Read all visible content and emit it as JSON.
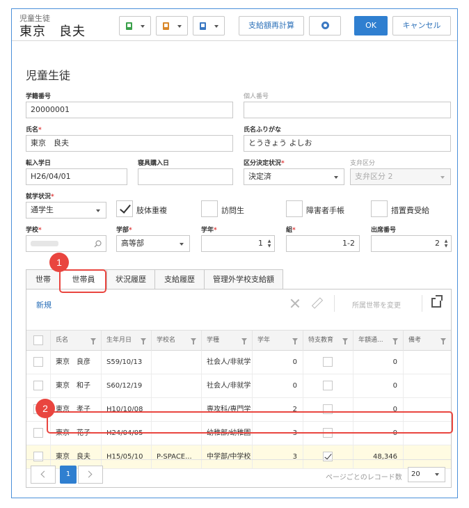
{
  "header": {
    "subtitle": "児童生徒",
    "name": "東京　良夫",
    "recalc_label": "支給額再計算",
    "ok_label": "OK",
    "cancel_label": "キャンセル"
  },
  "page_title": "児童生徒",
  "form": {
    "student_no_label": "学籍番号",
    "student_no_value": "20000001",
    "personal_no_label": "個人番号",
    "personal_no_value": "",
    "name_label": "氏名",
    "name_value": "東京　良夫",
    "kana_label": "氏名ふりがな",
    "kana_value": "とうきょう よしお",
    "transfer_date_label": "転入学日",
    "transfer_date_value": "H26/04/01",
    "bedding_date_label": "寝具購入日",
    "bedding_date_value": "",
    "category_status_label": "区分決定状況",
    "category_status_value": "決定済",
    "payment_category_label": "支弁区分",
    "payment_category_value": "支弁区分 2",
    "enrollment_label": "就学状況",
    "enrollment_value": "通学生",
    "check_limb": "肢体重複",
    "check_visiting": "訪問生",
    "check_disability": "障害者手帳",
    "check_measures": "措置費受給",
    "school_label": "学校",
    "dept_label": "学部",
    "dept_value": "高等部",
    "grade_label": "学年",
    "grade_value": "1",
    "class_label": "組",
    "class_value": "1-2",
    "seat_label": "出席番号",
    "seat_value": "2",
    "required_mark": "*"
  },
  "tabs": [
    "世帯",
    "世帯員",
    "状況履歴",
    "支給履歴",
    "管理外学校支給額"
  ],
  "grid": {
    "new_label": "新規",
    "change_label": "所属世帯を変更",
    "columns": [
      "氏名",
      "生年月日",
      "学校名",
      "学種",
      "学年",
      "特支教育",
      "年額通...",
      "備考"
    ],
    "rows": [
      {
        "name": "東京　良彦",
        "birth": "S59/10/13",
        "school": "",
        "type": "社会人/非就学",
        "grade": "0",
        "special": false,
        "amount": "0",
        "note": ""
      },
      {
        "name": "東京　和子",
        "birth": "S60/12/19",
        "school": "",
        "type": "社会人/非就学",
        "grade": "0",
        "special": false,
        "amount": "0",
        "note": ""
      },
      {
        "name": "東京　孝子",
        "birth": "H10/10/08",
        "school": "",
        "type": "専攻科/専門学",
        "grade": "2",
        "special": false,
        "amount": "0",
        "note": ""
      },
      {
        "name": "東京　花子",
        "birth": "H24/04/05",
        "school": "",
        "type": "幼稚部/幼稚園",
        "grade": "3",
        "special": false,
        "amount": "0",
        "note": ""
      },
      {
        "name": "東京　良夫",
        "birth": "H15/05/10",
        "school": "P-SPACE...",
        "type": "中学部/中学校",
        "grade": "3",
        "special": true,
        "amount": "48,346",
        "note": ""
      }
    ]
  },
  "pager": {
    "current_page": "1",
    "page_size_label": "ページごとのレコード数",
    "page_size_value": "20"
  },
  "callouts": [
    "1",
    "2"
  ],
  "colors": {
    "accent": "#2f7fd0",
    "callout": "#e9453f",
    "selected_row": "#fffbe2"
  },
  "icons": [
    "green-document-icon",
    "orange-document-icon",
    "blue-document-icon",
    "help-icon",
    "search-icon",
    "delete-icon",
    "edit-icon",
    "expand-window-icon",
    "filter-icon"
  ]
}
